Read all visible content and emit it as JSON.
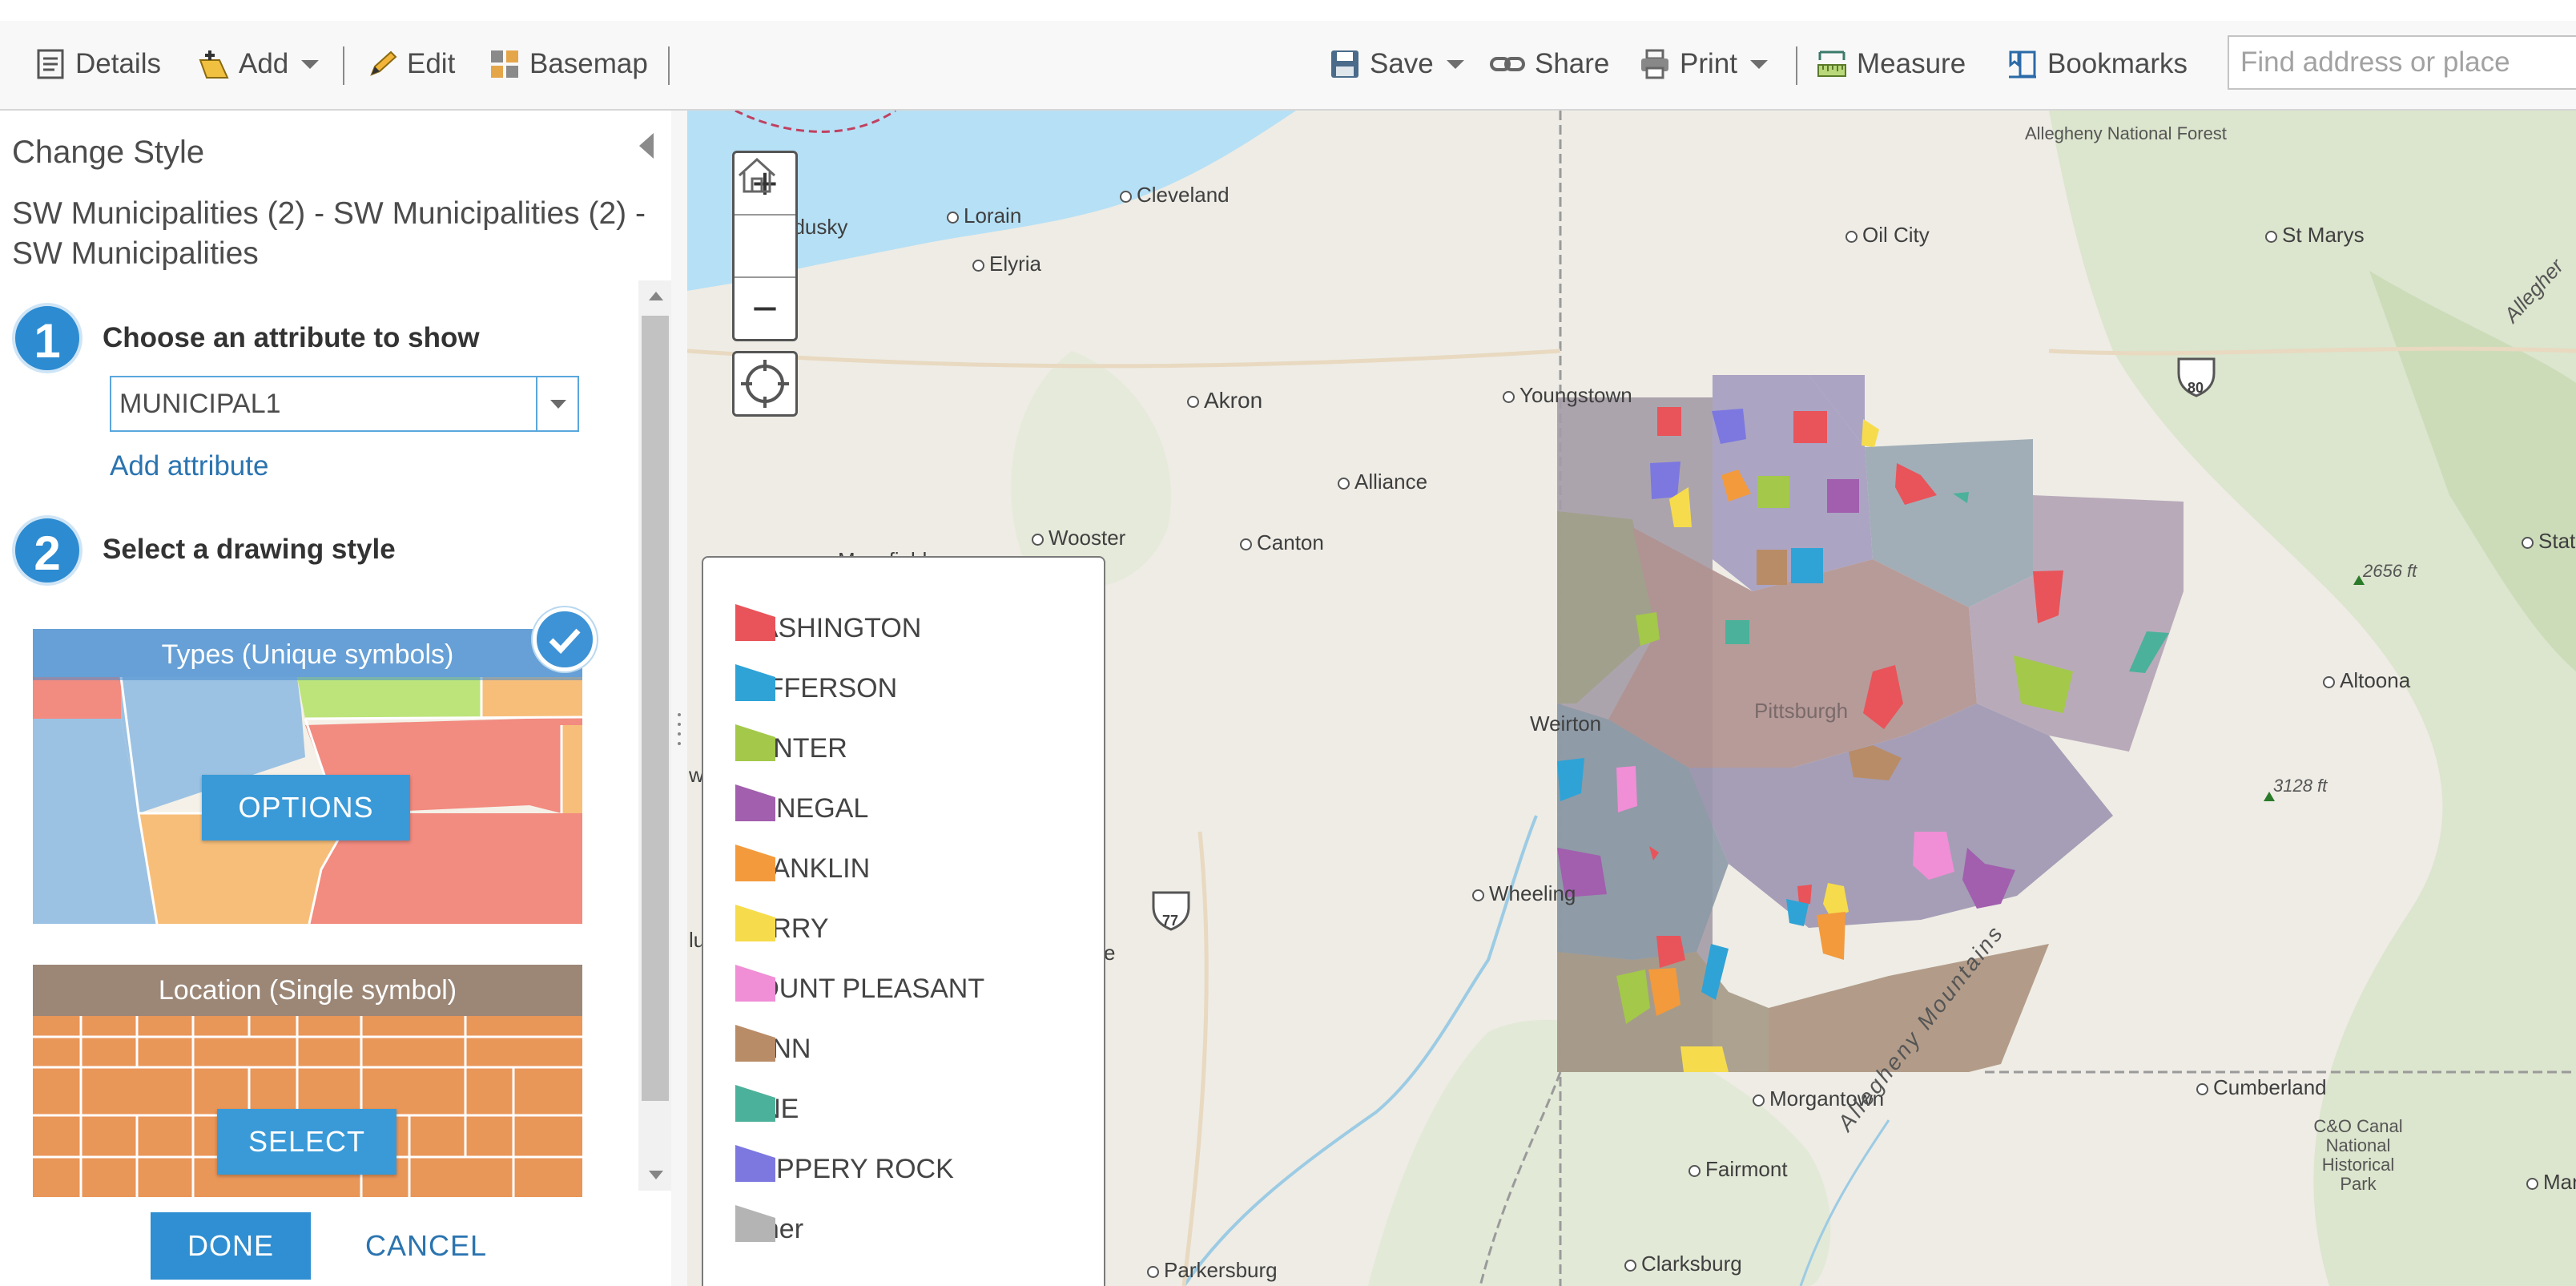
{
  "toolbar": {
    "details": "Details",
    "add": "Add",
    "edit": "Edit",
    "basemap": "Basemap",
    "save": "Save",
    "share": "Share",
    "print": "Print",
    "measure": "Measure",
    "bookmarks": "Bookmarks",
    "search_placeholder": "Find address or place"
  },
  "panel": {
    "title": "Change Style",
    "subtitle": "SW Municipalities (2) - SW Municipalities (2) - SW Municipalities",
    "step1_number": "1",
    "step1_label": "Choose an attribute to show",
    "attribute_value": "MUNICIPAL1",
    "add_attribute": "Add attribute",
    "step2_number": "2",
    "step2_label": "Select a drawing style",
    "style_types": {
      "caption": "Types (Unique symbols)",
      "action": "OPTIONS",
      "selected": true
    },
    "style_location": {
      "caption": "Location (Single symbol)",
      "action": "SELECT"
    },
    "done": "DONE",
    "cancel": "CANCEL"
  },
  "map": {
    "zoom_in": "+",
    "zoom_out": "−",
    "places": [
      "Allegheny National Forest",
      "Cleveland",
      "Lorain",
      "ndusky",
      "Elyria",
      "Oil City",
      "St Marys",
      "Akron",
      "Youngstown",
      "Alliance",
      "Wooster",
      "Canton",
      "Mansfield",
      "Pittsburgh",
      "Altoona",
      "State",
      "Wheeling",
      "Morgantown",
      "Cumberland",
      "C&O Canal National Historical Park",
      "Fairmont",
      "Clarksburg",
      "Parkersburg",
      "Martinsb",
      "Allegheny Mountains",
      "Allegher",
      "Weirton",
      "wa",
      "lu",
      "e"
    ],
    "elevations": [
      "2656 ft",
      "3128 ft"
    ],
    "interstates": [
      "80",
      "77"
    ]
  },
  "legend": {
    "items": [
      {
        "label": "WASHINGTON",
        "color": "#e8545a"
      },
      {
        "label": "JEFFERSON",
        "color": "#2fa3d6"
      },
      {
        "label": "CENTER",
        "color": "#a3c84a"
      },
      {
        "label": "DONEGAL",
        "color": "#a15fae"
      },
      {
        "label": "FRANKLIN",
        "color": "#f39a3c"
      },
      {
        "label": "PERRY",
        "color": "#f6dc4c"
      },
      {
        "label": "MOUNT PLEASANT",
        "color": "#f08ed6"
      },
      {
        "label": "PENN",
        "color": "#b98c68"
      },
      {
        "label": "PINE",
        "color": "#4cb19a"
      },
      {
        "label": "SLIPPERY ROCK",
        "color": "#7c78e0"
      },
      {
        "label": "Other",
        "color": "#b4b4b4"
      }
    ]
  },
  "colors": {
    "accent": "#2d8bd1",
    "link": "#2b74b0"
  }
}
